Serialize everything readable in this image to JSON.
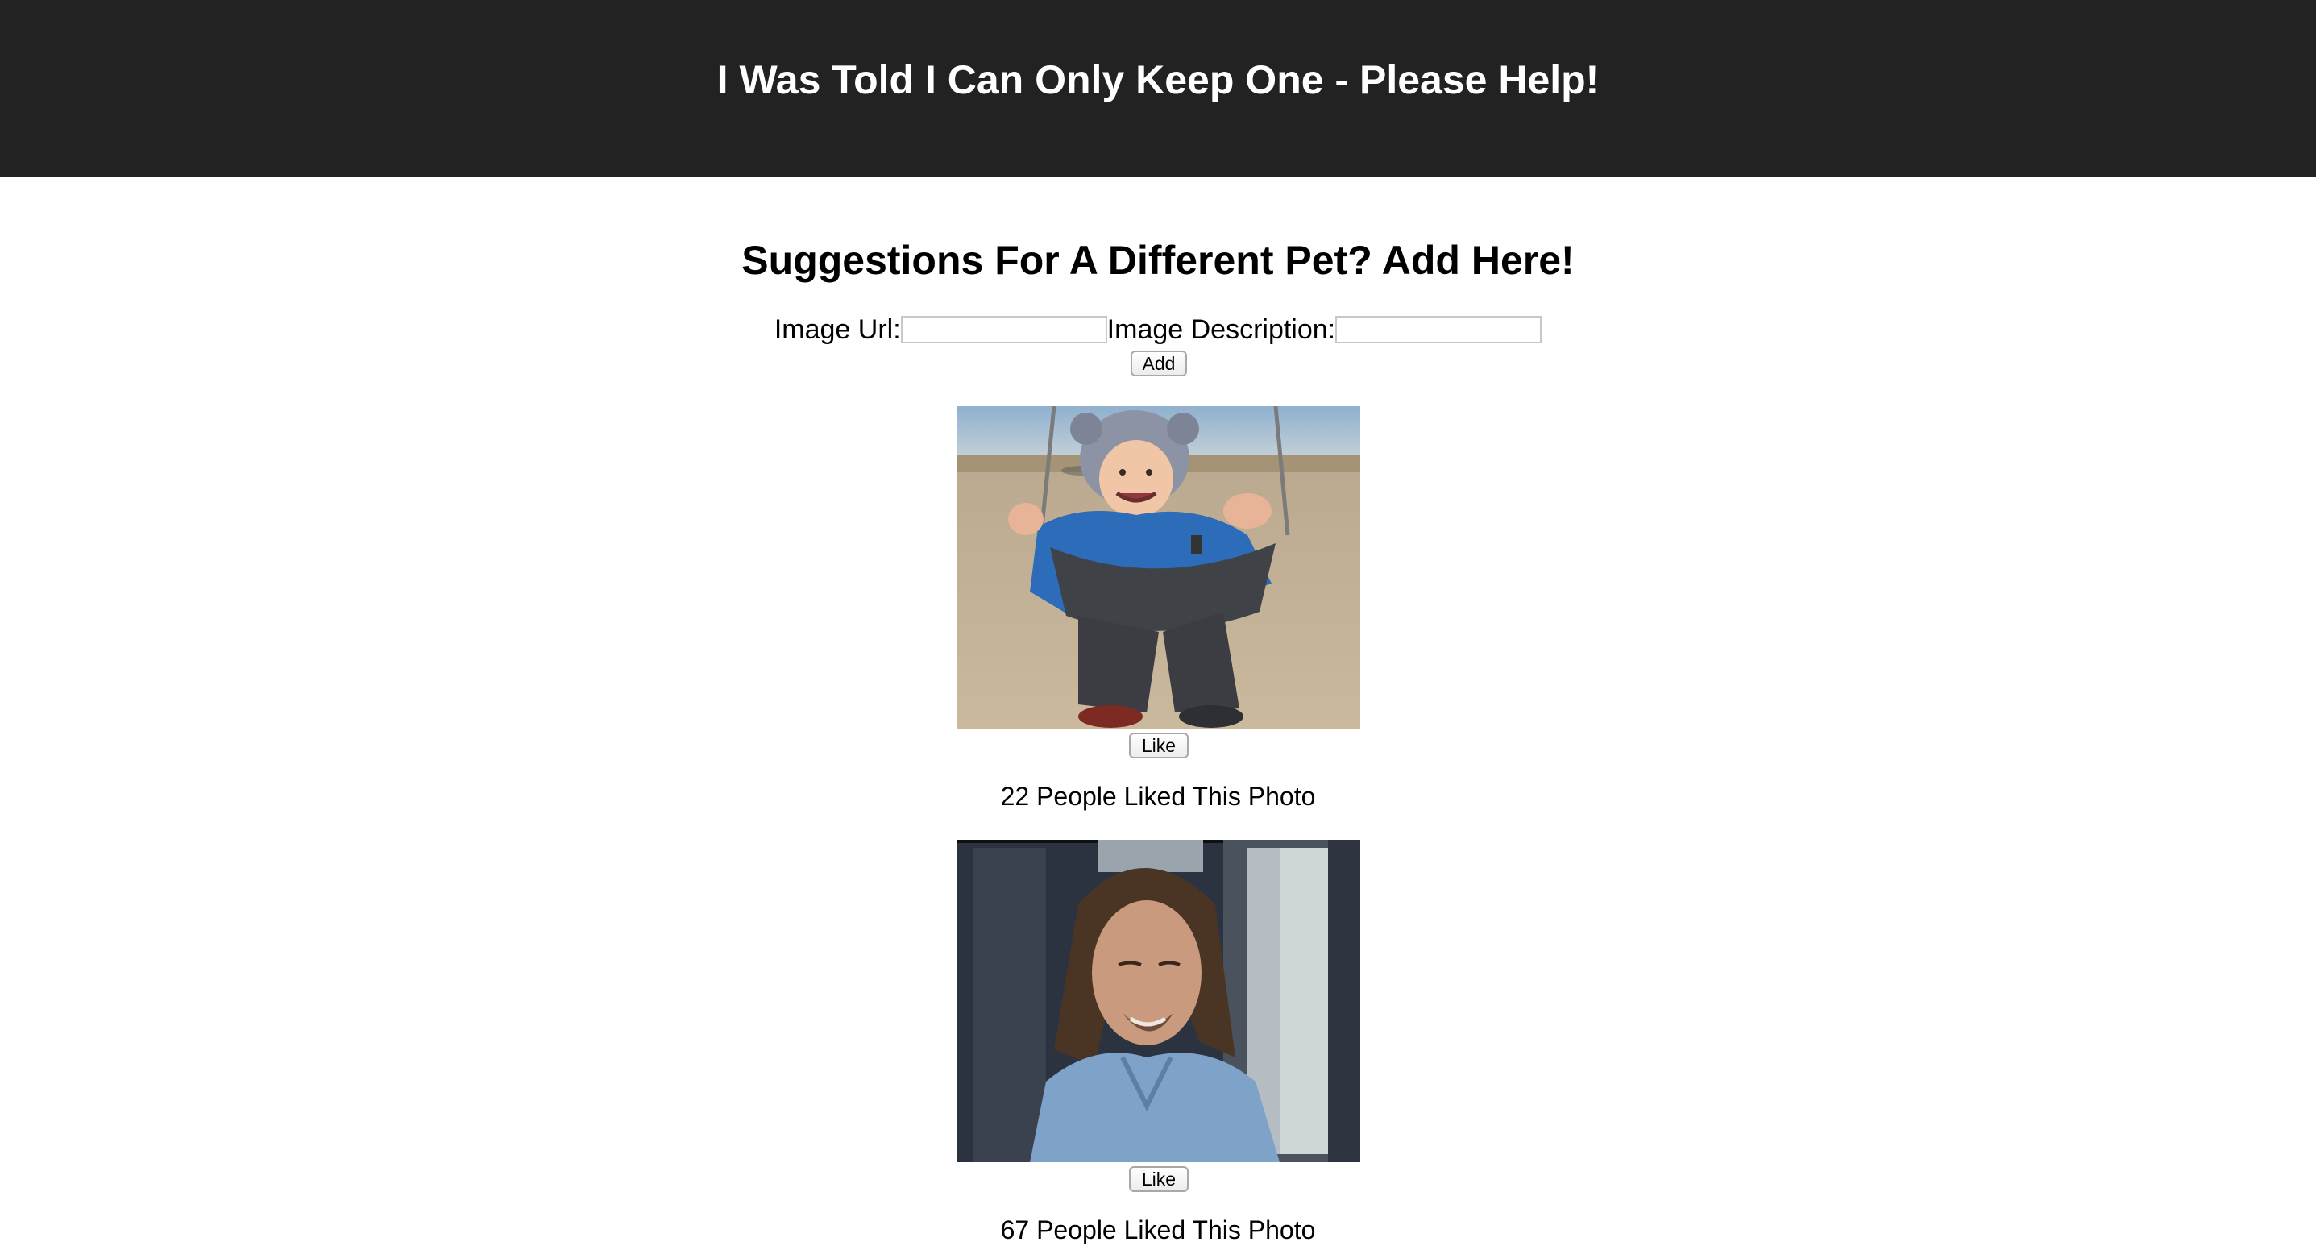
{
  "header": {
    "title": "I Was Told I Can Only Keep One - Please Help!",
    "background": "#222222",
    "text_color": "#ffffff"
  },
  "form": {
    "title": "Suggestions For A Different Pet? Add Here!",
    "image_url_label": "Image Url:",
    "image_url_value": "",
    "image_description_label": "Image Description:",
    "image_description_value": "",
    "add_button_label": "Add"
  },
  "photos": [
    {
      "subject": "toddler in a blue jacket and animal-ear hat on a swing at a beach",
      "like_button_label": "Like",
      "likes_text": "22 People Liked This Photo"
    },
    {
      "subject": "long-haired man with eyes closed in a bus window",
      "like_button_label": "Like",
      "likes_text": "67 People Liked This Photo"
    }
  ]
}
